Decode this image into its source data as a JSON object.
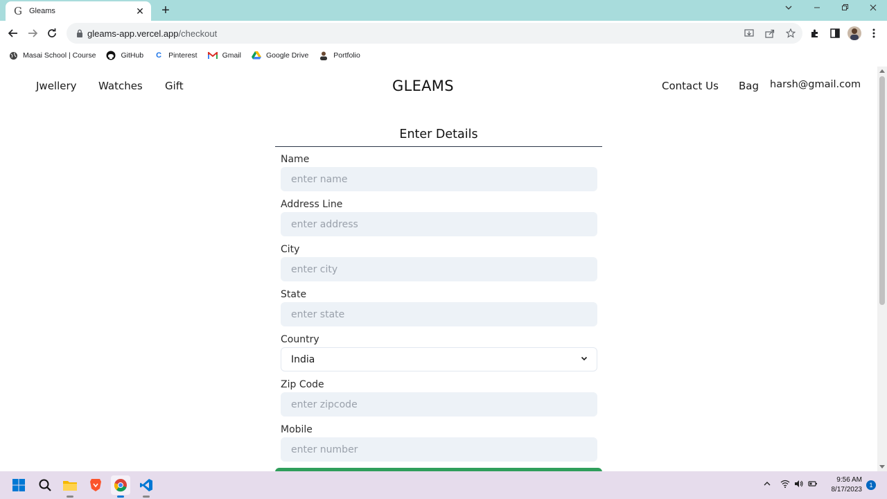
{
  "browser": {
    "tab_title": "Gleams",
    "tab_favicon": "G",
    "url_host": "gleams-app.vercel.app",
    "url_path": "/checkout",
    "bookmarks": [
      {
        "label": "Masai School | Course",
        "icon": "globe-icon"
      },
      {
        "label": "GitHub",
        "icon": "github-icon"
      },
      {
        "label": "Pinterest",
        "icon": "pinterest-icon"
      },
      {
        "label": "Gmail",
        "icon": "gmail-icon"
      },
      {
        "label": "Google Drive",
        "icon": "drive-icon"
      },
      {
        "label": "Portfolio",
        "icon": "portfolio-icon"
      }
    ]
  },
  "site": {
    "nav_left": [
      "Jwellery",
      "Watches",
      "Gift"
    ],
    "brand": "GLEAMS",
    "nav_right": [
      "Contact Us",
      "Bag"
    ],
    "user_email": "harsh@gmail.com"
  },
  "form": {
    "title": "Enter Details",
    "fields": {
      "name": {
        "label": "Name",
        "placeholder": "enter name"
      },
      "address": {
        "label": "Address Line",
        "placeholder": "enter address"
      },
      "city": {
        "label": "City",
        "placeholder": "enter city"
      },
      "state": {
        "label": "State",
        "placeholder": "enter state"
      },
      "country": {
        "label": "Country",
        "value": "India"
      },
      "zip": {
        "label": "Zip Code",
        "placeholder": "enter zipcode"
      },
      "mobile": {
        "label": "Mobile",
        "placeholder": "enter number"
      }
    },
    "submit_color": "#2f9e5b"
  },
  "taskbar": {
    "time": "9:56 AM",
    "date": "8/17/2023",
    "notification_count": "1"
  }
}
